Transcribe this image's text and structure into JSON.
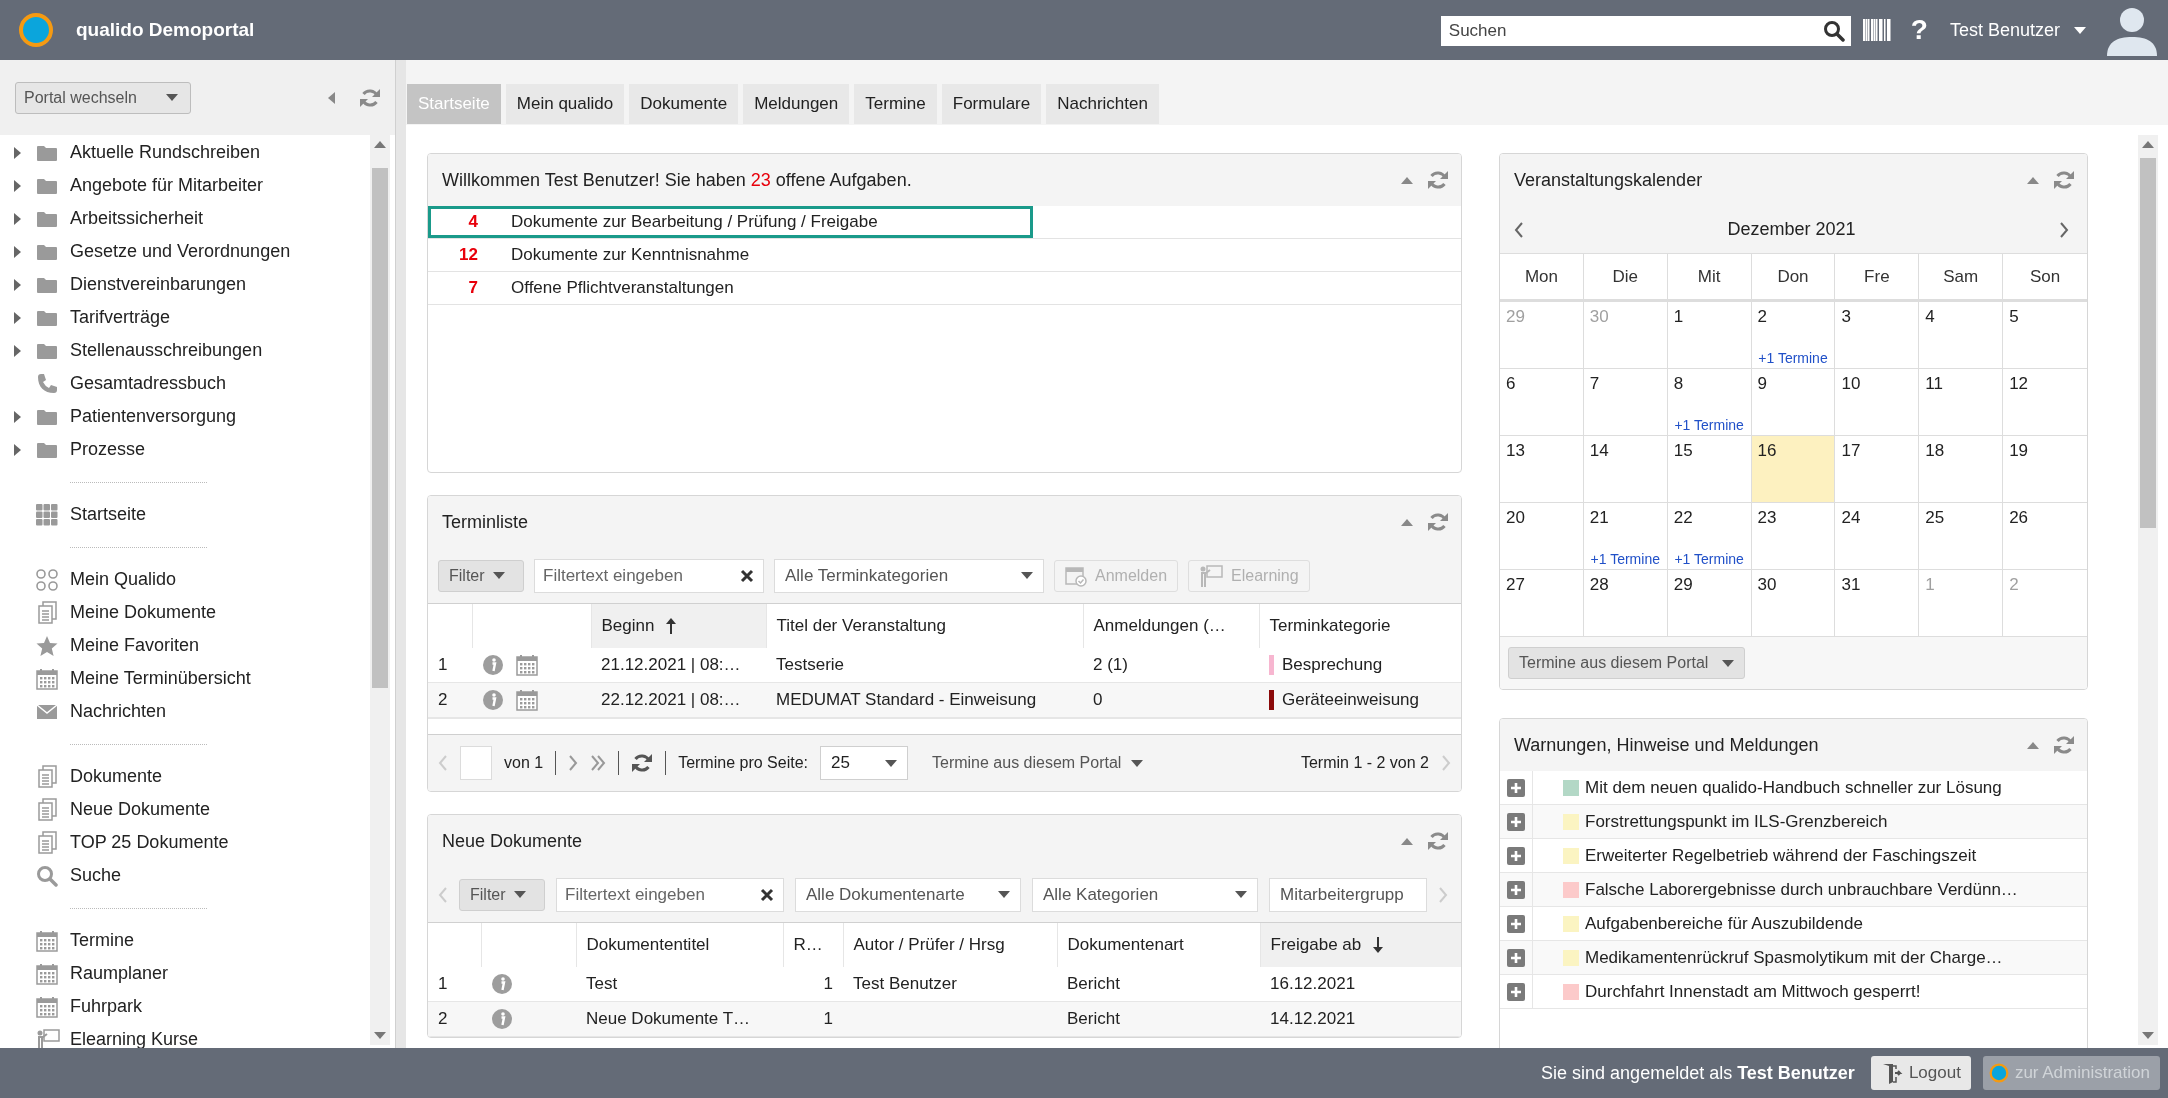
{
  "header": {
    "title": "qualido Demoportal",
    "search": {
      "placeholder": "Suchen"
    },
    "help": "?",
    "user": "Test Benutzer"
  },
  "sidebar": {
    "portal_select": "Portal wechseln",
    "sections": [
      {
        "items": [
          {
            "label": "Aktuelle Rundschreiben",
            "kind": "folder"
          },
          {
            "label": "Angebote für Mitarbeiter",
            "kind": "folder"
          },
          {
            "label": "Arbeitssicherheit",
            "kind": "folder"
          },
          {
            "label": "Gesetze und Verordnungen",
            "kind": "folder"
          },
          {
            "label": "Dienstvereinbarungen",
            "kind": "folder"
          },
          {
            "label": "Tarifverträge",
            "kind": "folder"
          },
          {
            "label": "Stellenausschreibungen",
            "kind": "folder"
          },
          {
            "label": "Gesamtadressbuch",
            "kind": "contact"
          },
          {
            "label": "Patientenversorgung",
            "kind": "folder"
          },
          {
            "label": "Prozesse",
            "kind": "folder"
          }
        ]
      },
      {
        "items": [
          {
            "label": "Startseite",
            "kind": "page"
          }
        ]
      },
      {
        "items": [
          {
            "label": "Mein Qualido",
            "kind": "checklist"
          },
          {
            "label": "Meine Dokumente",
            "kind": "documents"
          },
          {
            "label": "Meine Favoriten",
            "kind": "favorites"
          },
          {
            "label": "Meine Terminübersicht",
            "kind": "calendar"
          },
          {
            "label": "Nachrichten",
            "kind": "messages"
          }
        ]
      },
      {
        "items": [
          {
            "label": "Dokumente",
            "kind": "documents"
          },
          {
            "label": "Neue Dokumente",
            "kind": "documents"
          },
          {
            "label": "TOP 25 Dokumente",
            "kind": "documents"
          },
          {
            "label": "Suche",
            "kind": "search"
          }
        ]
      },
      {
        "items": [
          {
            "label": "Termine",
            "kind": "calendar"
          },
          {
            "label": "Raumplaner",
            "kind": "calendar"
          },
          {
            "label": "Fuhrpark",
            "kind": "calendar"
          },
          {
            "label": "Elearning Kurse",
            "kind": "course"
          }
        ]
      }
    ]
  },
  "tabs": [
    {
      "label": "Startseite",
      "selected": true
    },
    {
      "label": "Mein qualido",
      "selected": false
    },
    {
      "label": "Dokumente",
      "selected": false
    },
    {
      "label": "Meldungen",
      "selected": false
    },
    {
      "label": "Termine",
      "selected": false
    },
    {
      "label": "Formulare",
      "selected": false
    },
    {
      "label": "Nachrichten",
      "selected": false
    }
  ],
  "tasks": {
    "title": "Willkommen Test Benutzer! Sie haben **23** offene Aufgaben.",
    "rows": [
      {
        "count": "4",
        "label": "Dokumente zur Bearbeitung / Prüfung / Freigabe",
        "selected": true
      },
      {
        "count": "12",
        "label": "Dokumente zur Kenntnisnahme",
        "selected": false
      },
      {
        "count": "7",
        "label": "Offene Pflichtveranstaltungen",
        "selected": false
      }
    ]
  },
  "events": {
    "title": "Terminliste",
    "filter": "Filter",
    "search": {
      "placeholder": "Filtertext eingeben"
    },
    "category_select": "Alle Terminkategorien",
    "actions": [
      {
        "label": "Anmelden",
        "kind": "register",
        "disabled": true
      },
      {
        "label": "Elearning",
        "kind": "course",
        "disabled": true
      }
    ],
    "columns": [
      {
        "label": "Beginn",
        "sorted": true,
        "descending": false
      },
      {
        "label": "Titel der Veranstaltung",
        "sorted": false
      },
      {
        "label": "Anmeldungen (…",
        "sorted": false
      },
      {
        "label": "Terminkategorie",
        "sorted": false
      }
    ],
    "rows": [
      {
        "num": "1",
        "begin": "21.12.2021 | 08:…",
        "title": "Testserie",
        "registrations": "2 (1)",
        "category": "Besprechung",
        "color": "#f7b6d0"
      },
      {
        "num": "2",
        "begin": "22.12.2021 | 08:…",
        "title": "MEDUMAT Standard - Einweisung",
        "registrations": "0",
        "category": "Geräteeinweisung",
        "color": "#8b0a0a"
      }
    ],
    "pager": {
      "of": "von 1",
      "per_page_label": "Termine pro Seite:",
      "per_page": "25",
      "scope": "Termine aus diesem Portal",
      "range": "Termin 1 - 2 von 2"
    }
  },
  "documents": {
    "title": "Neue Dokumente",
    "filter": "Filter",
    "search": {
      "placeholder": "Filtertext eingeben"
    },
    "selects": [
      "Alle Dokumentenarte",
      "Alle Kategorien",
      "Mitarbeitergrupp"
    ],
    "columns": [
      {
        "label": "Dokumententitel",
        "sorted": false
      },
      {
        "label": "R…",
        "sorted": false
      },
      {
        "label": "Autor / Prüfer / Hrsg",
        "sorted": false
      },
      {
        "label": "Dokumentenart",
        "sorted": false
      },
      {
        "label": "Freigabe ab",
        "sorted": true,
        "descending": true
      }
    ],
    "rows": [
      {
        "num": "1",
        "title": "Test",
        "r": "1",
        "author": "Test Benutzer",
        "type": "Bericht",
        "released": "16.12.2021"
      },
      {
        "num": "2",
        "title": "Neue Dokumente T…",
        "r": "1",
        "type": "Bericht",
        "released": "14.12.2021"
      }
    ]
  },
  "calendar": {
    "title": "Veranstaltungskalender",
    "month": "Dezember 2021",
    "weekdays": [
      "Mon",
      "Die",
      "Mit",
      "Don",
      "Fre",
      "Sam",
      "Son"
    ],
    "days": [
      {
        "day": "29",
        "other_month": true,
        "today": false
      },
      {
        "day": "30",
        "other_month": true,
        "today": false
      },
      {
        "day": "1",
        "other_month": false,
        "today": false
      },
      {
        "day": "2",
        "other_month": false,
        "today": false,
        "events": "+1 Termine"
      },
      {
        "day": "3",
        "other_month": false,
        "today": false
      },
      {
        "day": "4",
        "other_month": false,
        "today": false
      },
      {
        "day": "5",
        "other_month": false,
        "today": false
      },
      {
        "day": "6",
        "other_month": false,
        "today": false
      },
      {
        "day": "7",
        "other_month": false,
        "today": false
      },
      {
        "day": "8",
        "other_month": false,
        "today": false,
        "events": "+1 Termine"
      },
      {
        "day": "9",
        "other_month": false,
        "today": false
      },
      {
        "day": "10",
        "other_month": false,
        "today": false
      },
      {
        "day": "11",
        "other_month": false,
        "today": false
      },
      {
        "day": "12",
        "other_month": false,
        "today": false
      },
      {
        "day": "13",
        "other_month": false,
        "today": false
      },
      {
        "day": "14",
        "other_month": false,
        "today": false
      },
      {
        "day": "15",
        "other_month": false,
        "today": false
      },
      {
        "day": "16",
        "other_month": false,
        "today": true
      },
      {
        "day": "17",
        "other_month": false,
        "today": false
      },
      {
        "day": "18",
        "other_month": false,
        "today": false
      },
      {
        "day": "19",
        "other_month": false,
        "today": false
      },
      {
        "day": "20",
        "other_month": false,
        "today": false
      },
      {
        "day": "21",
        "other_month": false,
        "today": false,
        "events": "+1 Termine"
      },
      {
        "day": "22",
        "other_month": false,
        "today": false,
        "events": "+1 Termine"
      },
      {
        "day": "23",
        "other_month": false,
        "today": false
      },
      {
        "day": "24",
        "other_month": false,
        "today": false
      },
      {
        "day": "25",
        "other_month": false,
        "today": false
      },
      {
        "day": "26",
        "other_month": false,
        "today": false
      },
      {
        "day": "27",
        "other_month": false,
        "today": false
      },
      {
        "day": "28",
        "other_month": false,
        "today": false
      },
      {
        "day": "29",
        "other_month": false,
        "today": false
      },
      {
        "day": "30",
        "other_month": false,
        "today": false
      },
      {
        "day": "31",
        "other_month": false,
        "today": false
      },
      {
        "day": "1",
        "other_month": true,
        "today": false
      },
      {
        "day": "2",
        "other_month": true,
        "today": false
      }
    ],
    "scope": "Termine aus diesem Portal"
  },
  "warnings": {
    "title": "Warnungen, Hinweise und Meldungen",
    "items": [
      {
        "text": "Mit dem neuen qualido-Handbuch schneller zur Lösung",
        "color": "#b3d8c6",
        "expanded": false
      },
      {
        "text": "Forstrettungspunkt im ILS-Grenzbereich",
        "color": "#fbf4c2",
        "expanded": false
      },
      {
        "text": "Erweiterter Regelbetrieb während der Faschingszeit",
        "color": "#fbf4c2",
        "expanded": false
      },
      {
        "text": "Falsche Laborergebnisse durch unbrauchbare Verdünn…",
        "color": "#fccaca",
        "expanded": false
      },
      {
        "text": "Aufgabenbereiche für Auszubildende",
        "color": "#fbf4c2",
        "expanded": false
      },
      {
        "text": "Medikamentenrückruf Spasmolytikum mit der Charge…",
        "color": "#fbf4c2",
        "expanded": false
      },
      {
        "text": "Durchfahrt Innenstadt am Mittwoch gesperrt!",
        "color": "#fccaca",
        "expanded": false
      }
    ]
  },
  "footer": {
    "login_text": "Sie sind angemeldet als **Test Benutzer**",
    "logout": "Logout",
    "admin": {
      "label": "zur Administration",
      "disabled": true
    }
  }
}
